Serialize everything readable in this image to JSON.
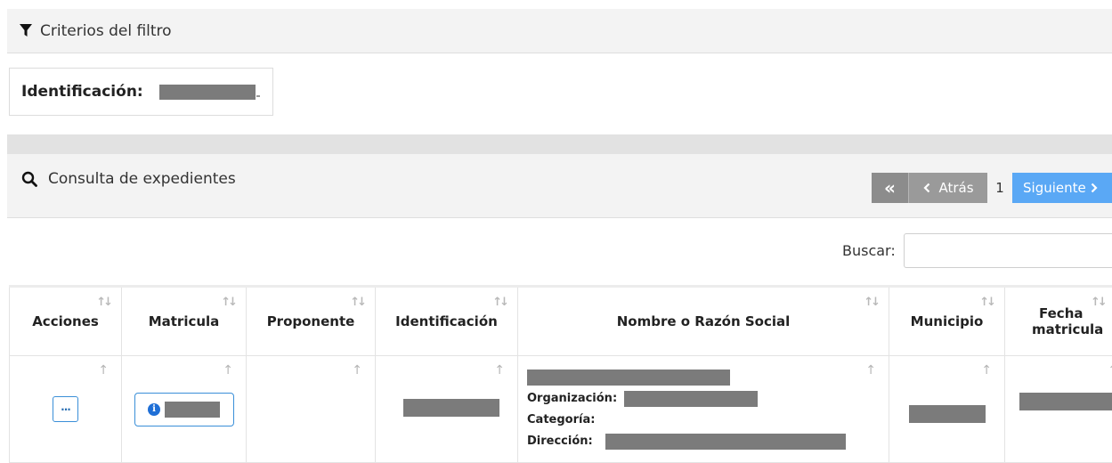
{
  "filter": {
    "title": "Criterios del filtro",
    "icon": "filter-icon",
    "identificacion_label": "Identificación:"
  },
  "consulta": {
    "title": "Consulta de expedientes",
    "icon": "search-icon"
  },
  "pager": {
    "first_icon": "«",
    "prev_label": "Atrás",
    "page": "1",
    "next_label": "Siguiente",
    "active_color": "#5aa8f5"
  },
  "search": {
    "label": "Buscar:",
    "value": ""
  },
  "table": {
    "headers": {
      "acciones": "Acciones",
      "matricula": "Matricula",
      "proponente": "Proponente",
      "identificacion": "Identificación",
      "nombre": "Nombre o Razón Social",
      "municipio": "Municipio",
      "fecha_line1": "Fecha",
      "fecha_line2": "matricula"
    },
    "row": {
      "actions_button": "···",
      "organizacion_label": "Organización:",
      "categoria_label": "Categoría:",
      "direccion_label": "Dirección:"
    }
  },
  "colors": {
    "redaction": "#7b7b7b",
    "header_bg": "#f3f3f3"
  }
}
